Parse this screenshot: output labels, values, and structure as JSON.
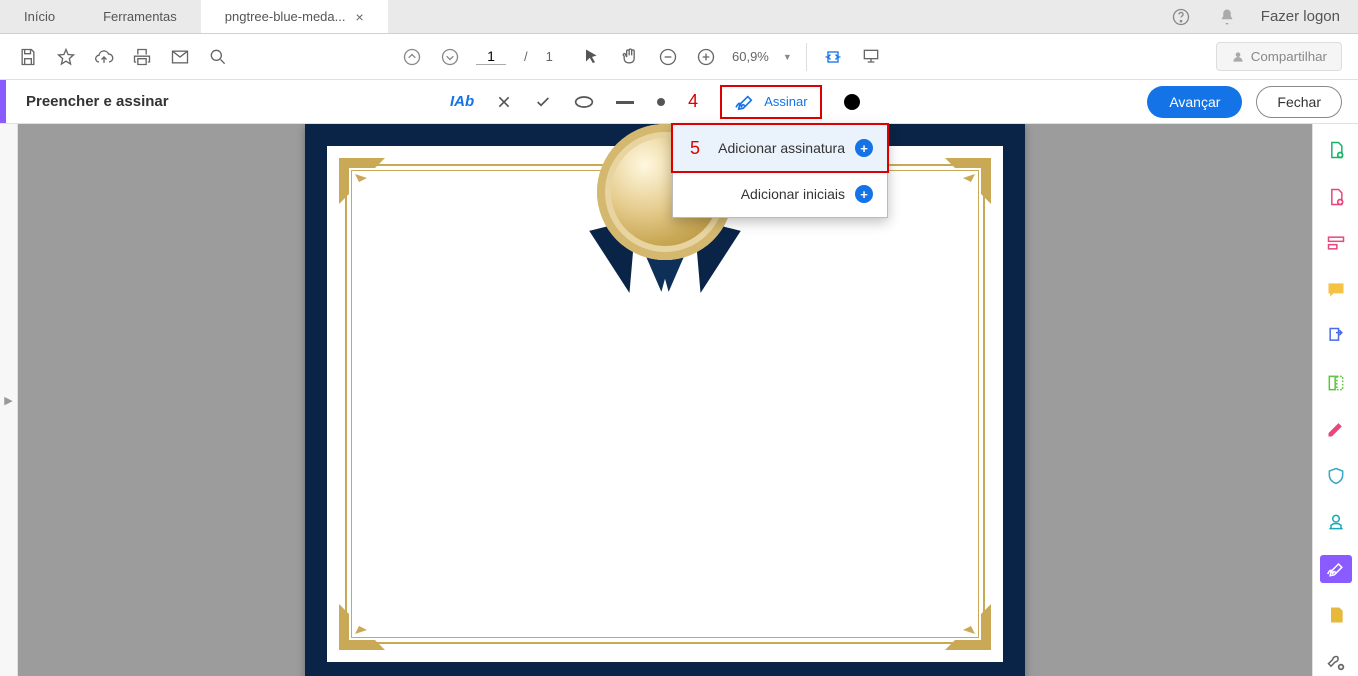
{
  "tabs": {
    "home": "Início",
    "tools": "Ferramentas",
    "doc": "pngtree-blue-meda..."
  },
  "header": {
    "login": "Fazer logon"
  },
  "toolbar": {
    "page_current": "1",
    "page_total": "1",
    "zoom": "60,9%",
    "share": "Compartilhar"
  },
  "fillbar": {
    "title": "Preencher e assinar",
    "ab": "Ab",
    "sign": "Assinar",
    "advance": "Avançar",
    "close": "Fechar"
  },
  "dropdown": {
    "add_signature": "Adicionar assinatura",
    "add_initials": "Adicionar iniciais"
  },
  "annotations": {
    "four": "4",
    "five": "5"
  }
}
